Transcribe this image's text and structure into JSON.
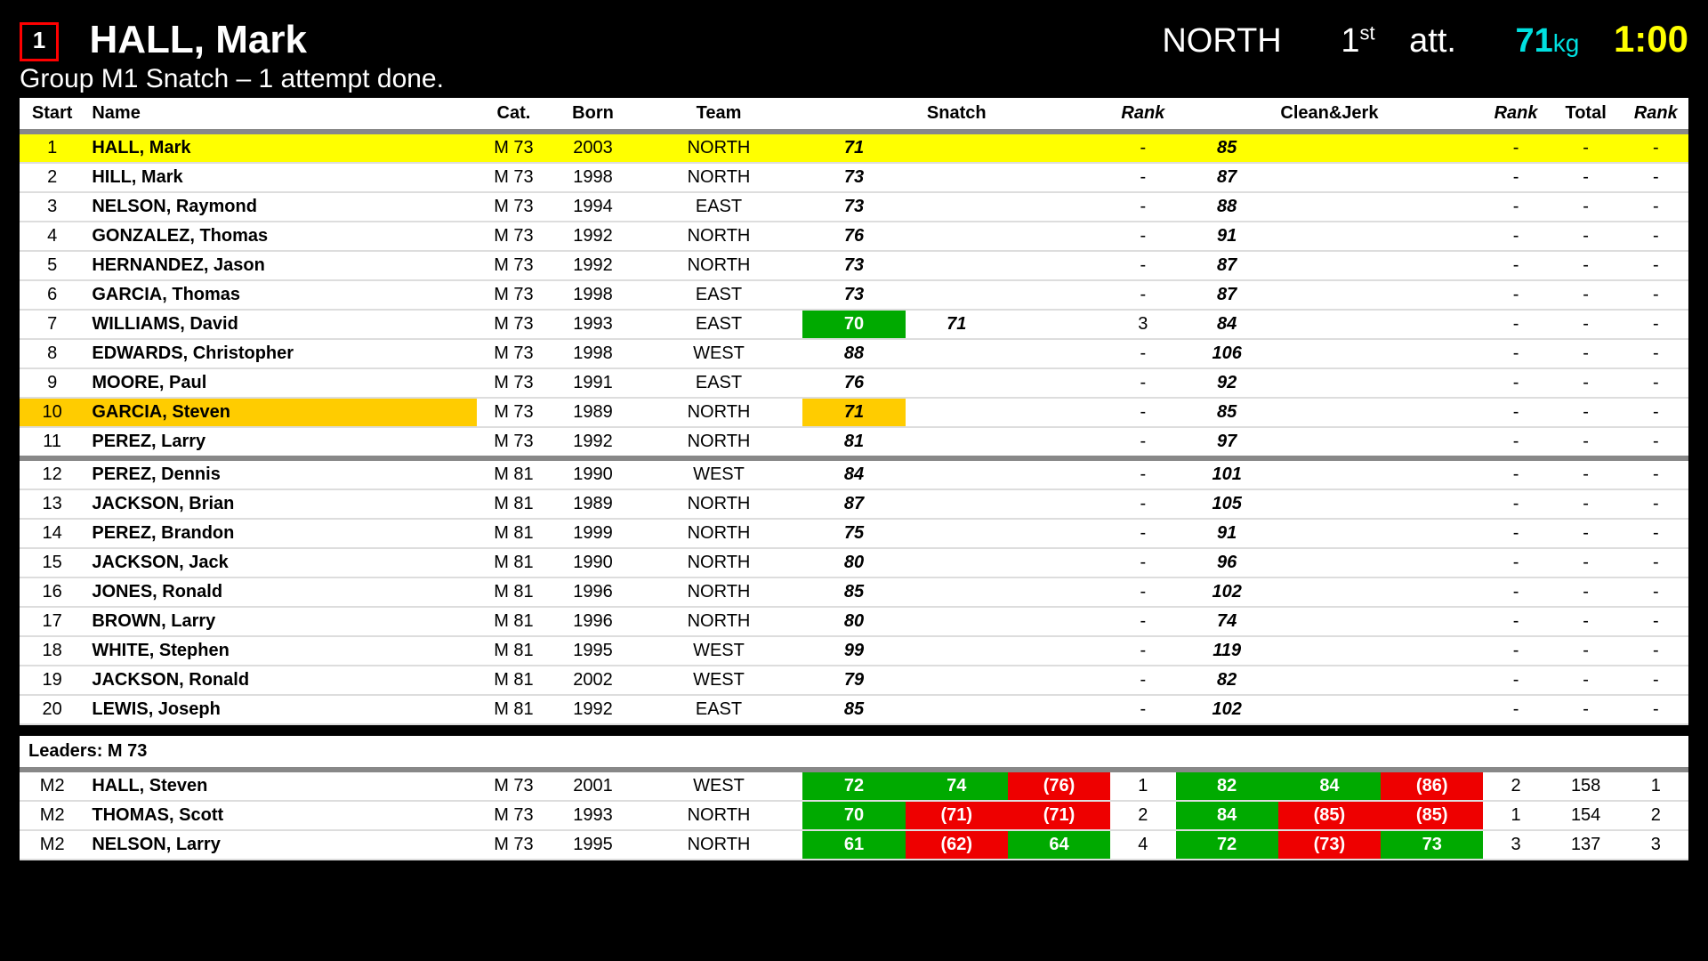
{
  "header": {
    "start": "1",
    "athlete": "HALL, Mark",
    "subline": "Group M1 Snatch – 1 attempt done.",
    "team": "NORTH",
    "attempt_ord": "1",
    "attempt_suffix": "st",
    "attempt_word": "att.",
    "weight": "71",
    "weight_unit": "kg",
    "clock": "1:00"
  },
  "columns": {
    "start": "Start",
    "name": "Name",
    "cat": "Cat.",
    "born": "Born",
    "team": "Team",
    "snatch": "Snatch",
    "rank": "Rank",
    "cj": "Clean&Jerk",
    "total": "Total"
  },
  "rows": [
    {
      "st": "1",
      "nm": "HALL, Mark",
      "cat": "M 73",
      "born": "2003",
      "team": "NORTH",
      "s": [
        "71",
        "",
        ""
      ],
      "sr": "-",
      "c": [
        "85",
        "",
        ""
      ],
      "cr": "-",
      "tot": "-",
      "tr": "-",
      "cls": "cur"
    },
    {
      "st": "2",
      "nm": "HILL, Mark",
      "cat": "M 73",
      "born": "1998",
      "team": "NORTH",
      "s": [
        "73",
        "",
        ""
      ],
      "sr": "-",
      "c": [
        "87",
        "",
        ""
      ],
      "cr": "-",
      "tot": "-",
      "tr": "-"
    },
    {
      "st": "3",
      "nm": "NELSON, Raymond",
      "cat": "M 73",
      "born": "1994",
      "team": "EAST",
      "s": [
        "73",
        "",
        ""
      ],
      "sr": "-",
      "c": [
        "88",
        "",
        ""
      ],
      "cr": "-",
      "tot": "-",
      "tr": "-"
    },
    {
      "st": "4",
      "nm": "GONZALEZ, Thomas",
      "cat": "M 73",
      "born": "1992",
      "team": "NORTH",
      "s": [
        "76",
        "",
        ""
      ],
      "sr": "-",
      "c": [
        "91",
        "",
        ""
      ],
      "cr": "-",
      "tot": "-",
      "tr": "-"
    },
    {
      "st": "5",
      "nm": "HERNANDEZ, Jason",
      "cat": "M 73",
      "born": "1992",
      "team": "NORTH",
      "s": [
        "73",
        "",
        ""
      ],
      "sr": "-",
      "c": [
        "87",
        "",
        ""
      ],
      "cr": "-",
      "tot": "-",
      "tr": "-"
    },
    {
      "st": "6",
      "nm": "GARCIA, Thomas",
      "cat": "M 73",
      "born": "1998",
      "team": "EAST",
      "s": [
        "73",
        "",
        ""
      ],
      "sr": "-",
      "c": [
        "87",
        "",
        ""
      ],
      "cr": "-",
      "tot": "-",
      "tr": "-"
    },
    {
      "st": "7",
      "nm": "WILLIAMS, David",
      "cat": "M 73",
      "born": "1993",
      "team": "EAST",
      "s": [
        {
          "v": "70",
          "k": "good"
        },
        "71",
        ""
      ],
      "sr": "3",
      "c": [
        "84",
        "",
        ""
      ],
      "cr": "-",
      "tot": "-",
      "tr": "-"
    },
    {
      "st": "8",
      "nm": "EDWARDS, Christopher",
      "cat": "M 73",
      "born": "1998",
      "team": "WEST",
      "s": [
        "88",
        "",
        ""
      ],
      "sr": "-",
      "c": [
        "106",
        "",
        ""
      ],
      "cr": "-",
      "tot": "-",
      "tr": "-"
    },
    {
      "st": "9",
      "nm": "MOORE, Paul",
      "cat": "M 73",
      "born": "1991",
      "team": "EAST",
      "s": [
        "76",
        "",
        ""
      ],
      "sr": "-",
      "c": [
        "92",
        "",
        ""
      ],
      "cr": "-",
      "tot": "-",
      "tr": "-"
    },
    {
      "st": "10",
      "nm": "GARCIA, Steven",
      "cat": "M 73",
      "born": "1989",
      "team": "NORTH",
      "s": [
        "71",
        "",
        ""
      ],
      "sr": "-",
      "c": [
        "85",
        "",
        ""
      ],
      "cr": "-",
      "tot": "-",
      "tr": "-",
      "cls": "nxt"
    },
    {
      "st": "11",
      "nm": "PEREZ, Larry",
      "cat": "M 73",
      "born": "1992",
      "team": "NORTH",
      "s": [
        "81",
        "",
        ""
      ],
      "sr": "-",
      "c": [
        "97",
        "",
        ""
      ],
      "cr": "-",
      "tot": "-",
      "tr": "-"
    },
    {
      "st": "12",
      "nm": "PEREZ, Dennis",
      "cat": "M 81",
      "born": "1990",
      "team": "WEST",
      "s": [
        "84",
        "",
        ""
      ],
      "sr": "-",
      "c": [
        "101",
        "",
        ""
      ],
      "cr": "-",
      "tot": "-",
      "tr": "-",
      "sep": true
    },
    {
      "st": "13",
      "nm": "JACKSON, Brian",
      "cat": "M 81",
      "born": "1989",
      "team": "NORTH",
      "s": [
        "87",
        "",
        ""
      ],
      "sr": "-",
      "c": [
        "105",
        "",
        ""
      ],
      "cr": "-",
      "tot": "-",
      "tr": "-"
    },
    {
      "st": "14",
      "nm": "PEREZ, Brandon",
      "cat": "M 81",
      "born": "1999",
      "team": "NORTH",
      "s": [
        "75",
        "",
        ""
      ],
      "sr": "-",
      "c": [
        "91",
        "",
        ""
      ],
      "cr": "-",
      "tot": "-",
      "tr": "-"
    },
    {
      "st": "15",
      "nm": "JACKSON, Jack",
      "cat": "M 81",
      "born": "1990",
      "team": "NORTH",
      "s": [
        "80",
        "",
        ""
      ],
      "sr": "-",
      "c": [
        "96",
        "",
        ""
      ],
      "cr": "-",
      "tot": "-",
      "tr": "-"
    },
    {
      "st": "16",
      "nm": "JONES, Ronald",
      "cat": "M 81",
      "born": "1996",
      "team": "NORTH",
      "s": [
        "85",
        "",
        ""
      ],
      "sr": "-",
      "c": [
        "102",
        "",
        ""
      ],
      "cr": "-",
      "tot": "-",
      "tr": "-"
    },
    {
      "st": "17",
      "nm": "BROWN, Larry",
      "cat": "M 81",
      "born": "1996",
      "team": "NORTH",
      "s": [
        "80",
        "",
        ""
      ],
      "sr": "-",
      "c": [
        "74",
        "",
        ""
      ],
      "cr": "-",
      "tot": "-",
      "tr": "-"
    },
    {
      "st": "18",
      "nm": "WHITE, Stephen",
      "cat": "M 81",
      "born": "1995",
      "team": "WEST",
      "s": [
        "99",
        "",
        ""
      ],
      "sr": "-",
      "c": [
        "119",
        "",
        ""
      ],
      "cr": "-",
      "tot": "-",
      "tr": "-"
    },
    {
      "st": "19",
      "nm": "JACKSON, Ronald",
      "cat": "M 81",
      "born": "2002",
      "team": "WEST",
      "s": [
        "79",
        "",
        ""
      ],
      "sr": "-",
      "c": [
        "82",
        "",
        ""
      ],
      "cr": "-",
      "tot": "-",
      "tr": "-"
    },
    {
      "st": "20",
      "nm": "LEWIS, Joseph",
      "cat": "M 81",
      "born": "1992",
      "team": "EAST",
      "s": [
        "85",
        "",
        ""
      ],
      "sr": "-",
      "c": [
        "102",
        "",
        ""
      ],
      "cr": "-",
      "tot": "-",
      "tr": "-"
    }
  ],
  "leaders": {
    "title": "Leaders: M 73",
    "rows": [
      {
        "st": "M2",
        "nm": "HALL, Steven",
        "cat": "M 73",
        "born": "2001",
        "team": "WEST",
        "s": [
          {
            "v": "72",
            "k": "good"
          },
          {
            "v": "74",
            "k": "good"
          },
          {
            "v": "(76)",
            "k": "bad"
          }
        ],
        "sr": "1",
        "c": [
          {
            "v": "82",
            "k": "good"
          },
          {
            "v": "84",
            "k": "good"
          },
          {
            "v": "(86)",
            "k": "bad"
          }
        ],
        "cr": "2",
        "tot": "158",
        "tr": "1"
      },
      {
        "st": "M2",
        "nm": "THOMAS, Scott",
        "cat": "M 73",
        "born": "1993",
        "team": "NORTH",
        "s": [
          {
            "v": "70",
            "k": "good"
          },
          {
            "v": "(71)",
            "k": "bad"
          },
          {
            "v": "(71)",
            "k": "bad"
          }
        ],
        "sr": "2",
        "c": [
          {
            "v": "84",
            "k": "good"
          },
          {
            "v": "(85)",
            "k": "bad"
          },
          {
            "v": "(85)",
            "k": "bad"
          }
        ],
        "cr": "1",
        "tot": "154",
        "tr": "2"
      },
      {
        "st": "M2",
        "nm": "NELSON, Larry",
        "cat": "M 73",
        "born": "1995",
        "team": "NORTH",
        "s": [
          {
            "v": "61",
            "k": "good"
          },
          {
            "v": "(62)",
            "k": "bad"
          },
          {
            "v": "64",
            "k": "good"
          }
        ],
        "sr": "4",
        "c": [
          {
            "v": "72",
            "k": "good"
          },
          {
            "v": "(73)",
            "k": "bad"
          },
          {
            "v": "73",
            "k": "good"
          }
        ],
        "cr": "3",
        "tot": "137",
        "tr": "3"
      }
    ]
  }
}
